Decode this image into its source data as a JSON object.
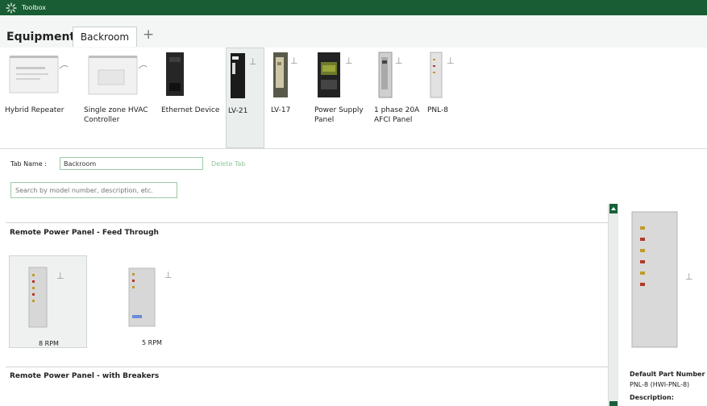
{
  "window": {
    "title": "Toolbox"
  },
  "tabs": {
    "equipment_label": "Equipment",
    "active_tab": "Backroom",
    "add_label": "+"
  },
  "devices": [
    {
      "label": "Hybrid Repeater"
    },
    {
      "label": "Single zone HVAC Controller"
    },
    {
      "label": "Ethernet Device"
    },
    {
      "label": "LV-21"
    },
    {
      "label": "LV-17"
    },
    {
      "label": "Power Supply Panel"
    },
    {
      "label": "1 phase 20A AFCI Panel"
    },
    {
      "label": "PNL-8"
    }
  ],
  "tab_name": {
    "label": "Tab Name :",
    "value": "Backroom",
    "delete_label": "Delete Tab"
  },
  "search": {
    "placeholder": "Search by model number, description, etc."
  },
  "sections": [
    {
      "title": "Remote Power Panel - Feed Through",
      "items": [
        {
          "label": "8 RPM"
        },
        {
          "label": "5 RPM"
        }
      ]
    },
    {
      "title": "Remote Power Panel - with Breakers"
    }
  ],
  "detail": {
    "default_part_label": "Default Part Number",
    "default_part_value": "PNL-8 (HWI-PNL-8)",
    "description_label": "Description:"
  },
  "colors": {
    "titlebar": "#185d33",
    "accent": "#18603a",
    "input_border": "#9acaa3"
  }
}
